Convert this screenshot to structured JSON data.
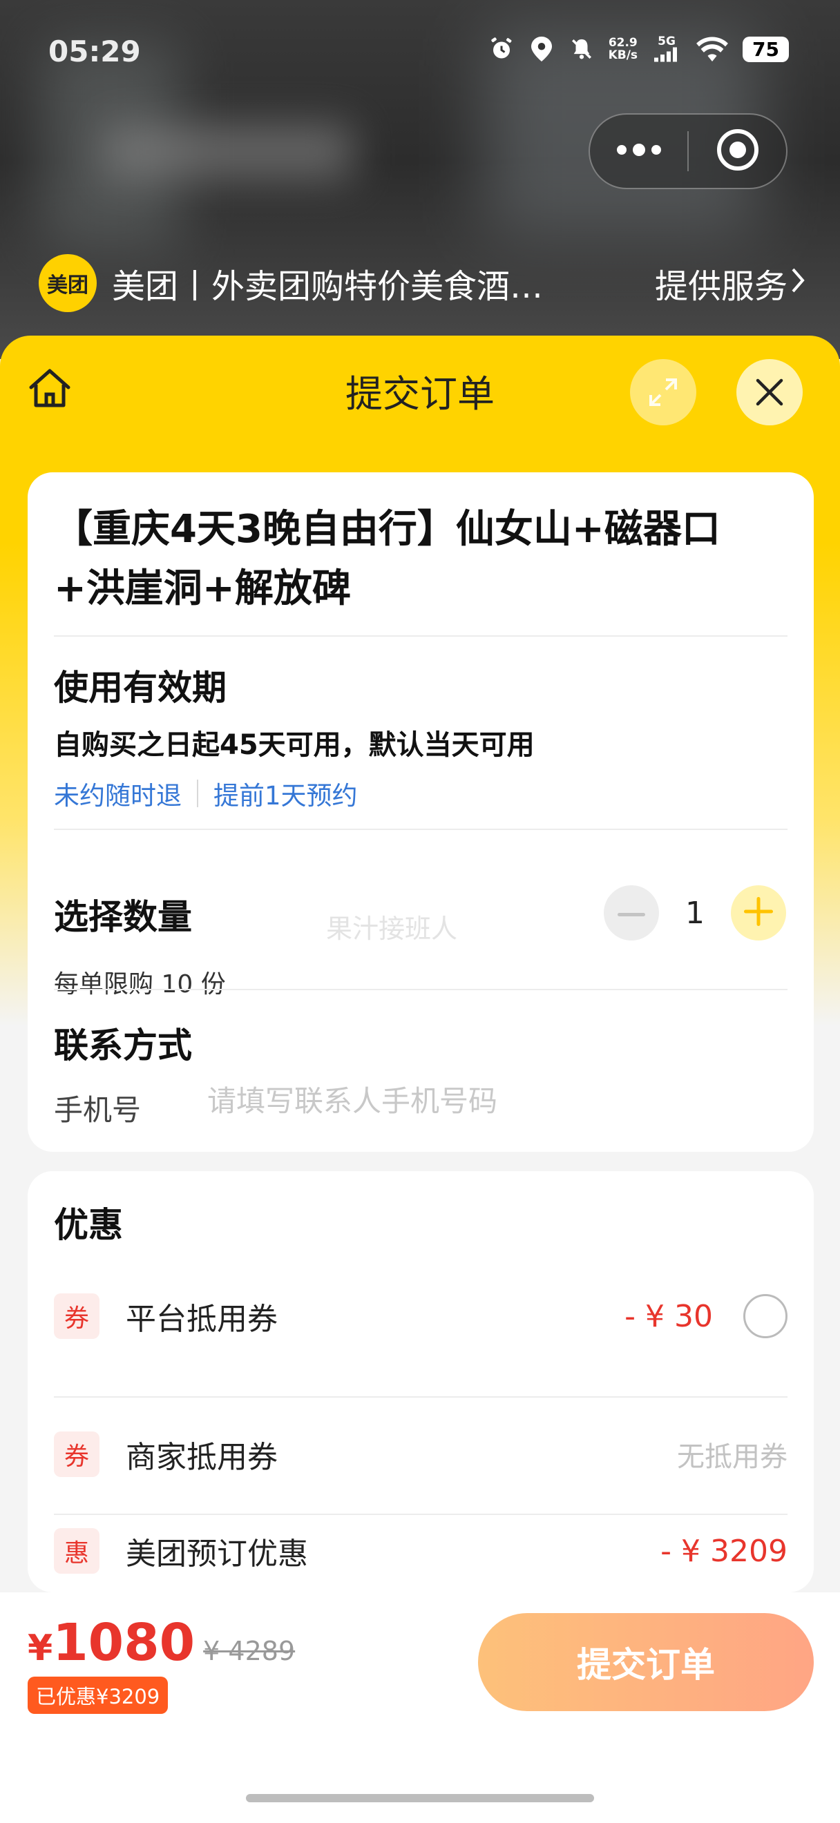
{
  "status_bar": {
    "time": "05:29",
    "net_speed_top": "62.9",
    "net_speed_bottom": "KB/s",
    "network": "5G",
    "battery": "75",
    "icons": [
      "alarm-icon",
      "location-icon",
      "bell-mute-icon",
      "signal-icon",
      "wifi-icon"
    ]
  },
  "mini_program": {
    "logo_text": "美团",
    "title": "美团丨外卖团购特价美食酒…",
    "service_label": "提供服务"
  },
  "sheet": {
    "title": "提交订单",
    "icons": [
      "home-icon",
      "expand-icon",
      "close-icon"
    ]
  },
  "product": {
    "title": "【重庆4天3晚自由行】仙女山+磁器口+洪崖洞+解放碑"
  },
  "validity": {
    "label": "使用有效期",
    "text": "自购买之日起45天可用，默认当天可用",
    "tags": [
      "未约随时退",
      "提前1天预约"
    ]
  },
  "quantity": {
    "label": "选择数量",
    "watermark": "果汁接班人",
    "value": "1",
    "limit": "每单限购 10 份"
  },
  "contact": {
    "label": "联系方式",
    "phone_label": "手机号",
    "phone_value": "",
    "phone_placeholder": "请填写联系人手机号码"
  },
  "discounts": {
    "title": "优惠",
    "rows": [
      {
        "badge": "券",
        "name": "平台抵用券",
        "amount": "- ¥ 30"
      },
      {
        "badge": "券",
        "name": "商家抵用券",
        "amount": "无抵用券"
      },
      {
        "badge": "惠",
        "name": "美团预订优惠",
        "amount": "- ¥ 3209"
      }
    ]
  },
  "footer": {
    "currency": "¥",
    "price": "1080",
    "original_price": "¥ 4289",
    "saved": "已优惠¥3209",
    "submit_label": "提交订单"
  },
  "colors": {
    "brand_yellow": "#ffd300",
    "price_red": "#e8352c",
    "link_blue": "#3577d6",
    "submit_gradient_start": "#fdc17a",
    "submit_gradient_end": "#ffa584"
  }
}
